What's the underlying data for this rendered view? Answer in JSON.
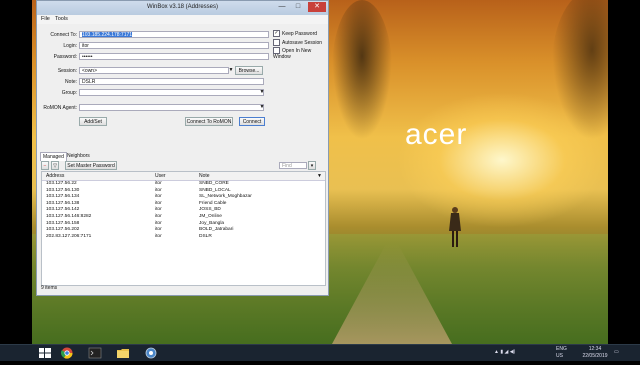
{
  "window": {
    "title": "WinBox v3.18 (Addresses)",
    "minimize": "—",
    "maximize": "□",
    "close": "✕"
  },
  "menu": [
    "File",
    "Tools"
  ],
  "form": {
    "connect_to_label": "Connect To:",
    "connect_to_value": "103.185.224.178:7171",
    "login_label": "Login:",
    "login_value": "itor",
    "password_label": "Password:",
    "password_value": "••••••",
    "session_label": "Session:",
    "session_value": "<own>",
    "browse_label": "Browse...",
    "note_label": "Note:",
    "note_value": "DSLR",
    "group_label": "Group:",
    "group_value": "",
    "romon_agent_label": "RoMON Agent:",
    "romon_agent_value": "",
    "keep_password": "Keep Password",
    "autosave_session": "Autosave Session",
    "open_in_new_window": "Open In New Window"
  },
  "buttons": {
    "add_set": "Add/Set",
    "connect_to_romon": "Connect To RoMON",
    "connect": "Connect",
    "set_master_password": "Set Master Password"
  },
  "tabs": [
    "Managed",
    "Neighbors"
  ],
  "find_placeholder": "Find",
  "table": {
    "headers": [
      "Address",
      "User",
      "Note"
    ],
    "rows": [
      {
        "address": "103.127.56.22",
        "user": "itor",
        "note": "SNBD_CORE"
      },
      {
        "address": "103.127.56.130",
        "user": "itor",
        "note": "SNBD_LOCAL"
      },
      {
        "address": "103.127.56.134",
        "user": "itor",
        "note": "SL_Network_Moghbazar"
      },
      {
        "address": "103.127.56.138",
        "user": "itor",
        "note": "Friend Cable"
      },
      {
        "address": "103.127.56.142",
        "user": "itor",
        "note": "JOSS_BD"
      },
      {
        "address": "103.127.56.146:8282",
        "user": "itor",
        "note": "JM_Online"
      },
      {
        "address": "103.127.56.158",
        "user": "itor",
        "note": "Joy_Bangla"
      },
      {
        "address": "103.127.56.202",
        "user": "itor",
        "note": "BOLD_Jatrabari"
      },
      {
        "address": "202.83.127.206:7171",
        "user": "itor",
        "note": "DSLR"
      }
    ]
  },
  "status_bar": "9 items",
  "desktop": {
    "logo_text": "acer"
  },
  "taskbar": {
    "lang": "ENG",
    "region": "US",
    "time": "12:34",
    "date": "22/05/2019"
  },
  "colors": {
    "selection": "#3a78d8",
    "close_button": "#c8403a",
    "taskbar": "#1a2430"
  }
}
